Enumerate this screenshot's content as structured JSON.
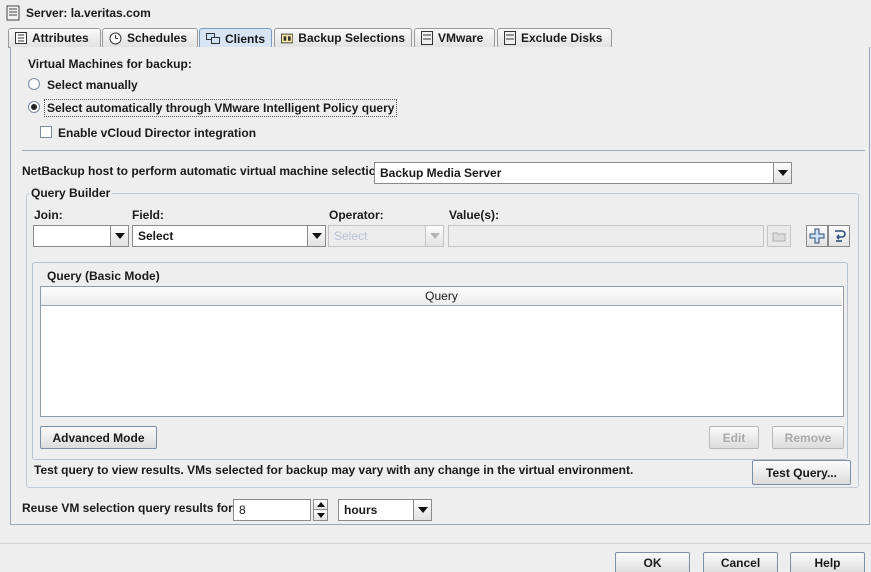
{
  "window": {
    "title": "Server: la.veritas.com"
  },
  "tabs": [
    {
      "label": "Attributes",
      "icon": "attributes-icon"
    },
    {
      "label": "Schedules",
      "icon": "schedules-icon"
    },
    {
      "label": "Clients",
      "icon": "clients-icon",
      "active": true
    },
    {
      "label": "Backup Selections",
      "icon": "backup-selections-icon"
    },
    {
      "label": "VMware",
      "icon": "vmware-icon"
    },
    {
      "label": "Exclude Disks",
      "icon": "exclude-disks-icon"
    }
  ],
  "vm_selection": {
    "heading": "Virtual Machines for backup:",
    "manual_label": "Select manually",
    "auto_label": "Select automatically through VMware Intelligent Policy query",
    "selected": "auto",
    "vcloud_label": "Enable vCloud Director integration",
    "vcloud_checked": false
  },
  "netbackup_host": {
    "label": "NetBackup host to perform automatic virtual machine selection:",
    "value": "Backup Media Server"
  },
  "query_builder": {
    "title": "Query Builder",
    "join_label": "Join:",
    "join_value": "",
    "field_label": "Field:",
    "field_value": "Select",
    "operator_label": "Operator:",
    "operator_value": "Select",
    "values_label": "Value(s):",
    "values_value": "",
    "query_panel_title": "Query (Basic Mode)",
    "query_column": "Query",
    "query_rows": [],
    "advanced_button": "Advanced Mode",
    "edit_button": "Edit",
    "remove_button": "Remove",
    "test_note": "Test query to view results. VMs selected for backup may vary with any change in the virtual environment.",
    "test_button": "Test Query..."
  },
  "reuse": {
    "label": "Reuse VM selection query results for:",
    "value": "8",
    "unit": "hours"
  },
  "footer": {
    "ok": "OK",
    "cancel": "Cancel",
    "help": "Help"
  }
}
